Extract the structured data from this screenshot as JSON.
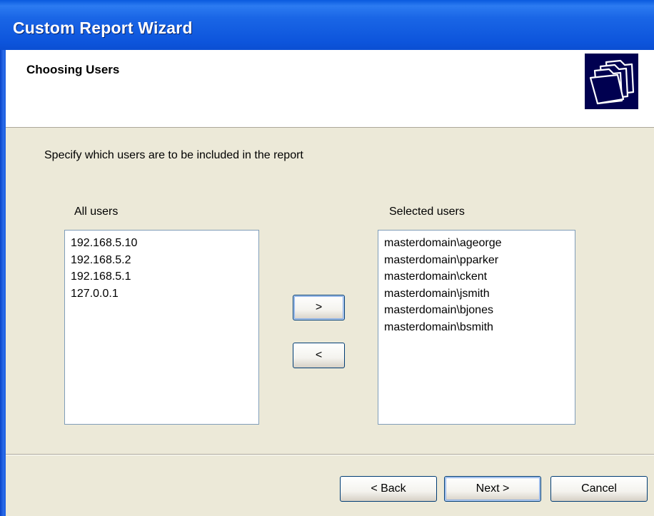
{
  "window": {
    "title": "Custom Report Wizard"
  },
  "header": {
    "title": "Choosing Users",
    "icon": "folders-icon"
  },
  "main": {
    "instruction": "Specify which users are to be included in the report",
    "all_users": {
      "label": "All users",
      "items": [
        "192.168.5.10",
        "192.168.5.2",
        "192.168.5.1",
        "127.0.0.1"
      ]
    },
    "selected_users": {
      "label": "Selected users",
      "items": [
        "masterdomain\\ageorge",
        "masterdomain\\pparker",
        "masterdomain\\ckent",
        "masterdomain\\jsmith",
        "masterdomain\\bjones",
        "masterdomain\\bsmith"
      ]
    },
    "add_label": ">",
    "remove_label": "<"
  },
  "footer": {
    "back_label": "< Back",
    "next_label": "Next >",
    "cancel_label": "Cancel"
  },
  "colors": {
    "titlebar": "#0A5ADF",
    "background": "#ECE9D8",
    "icon_bg": "#000050"
  }
}
